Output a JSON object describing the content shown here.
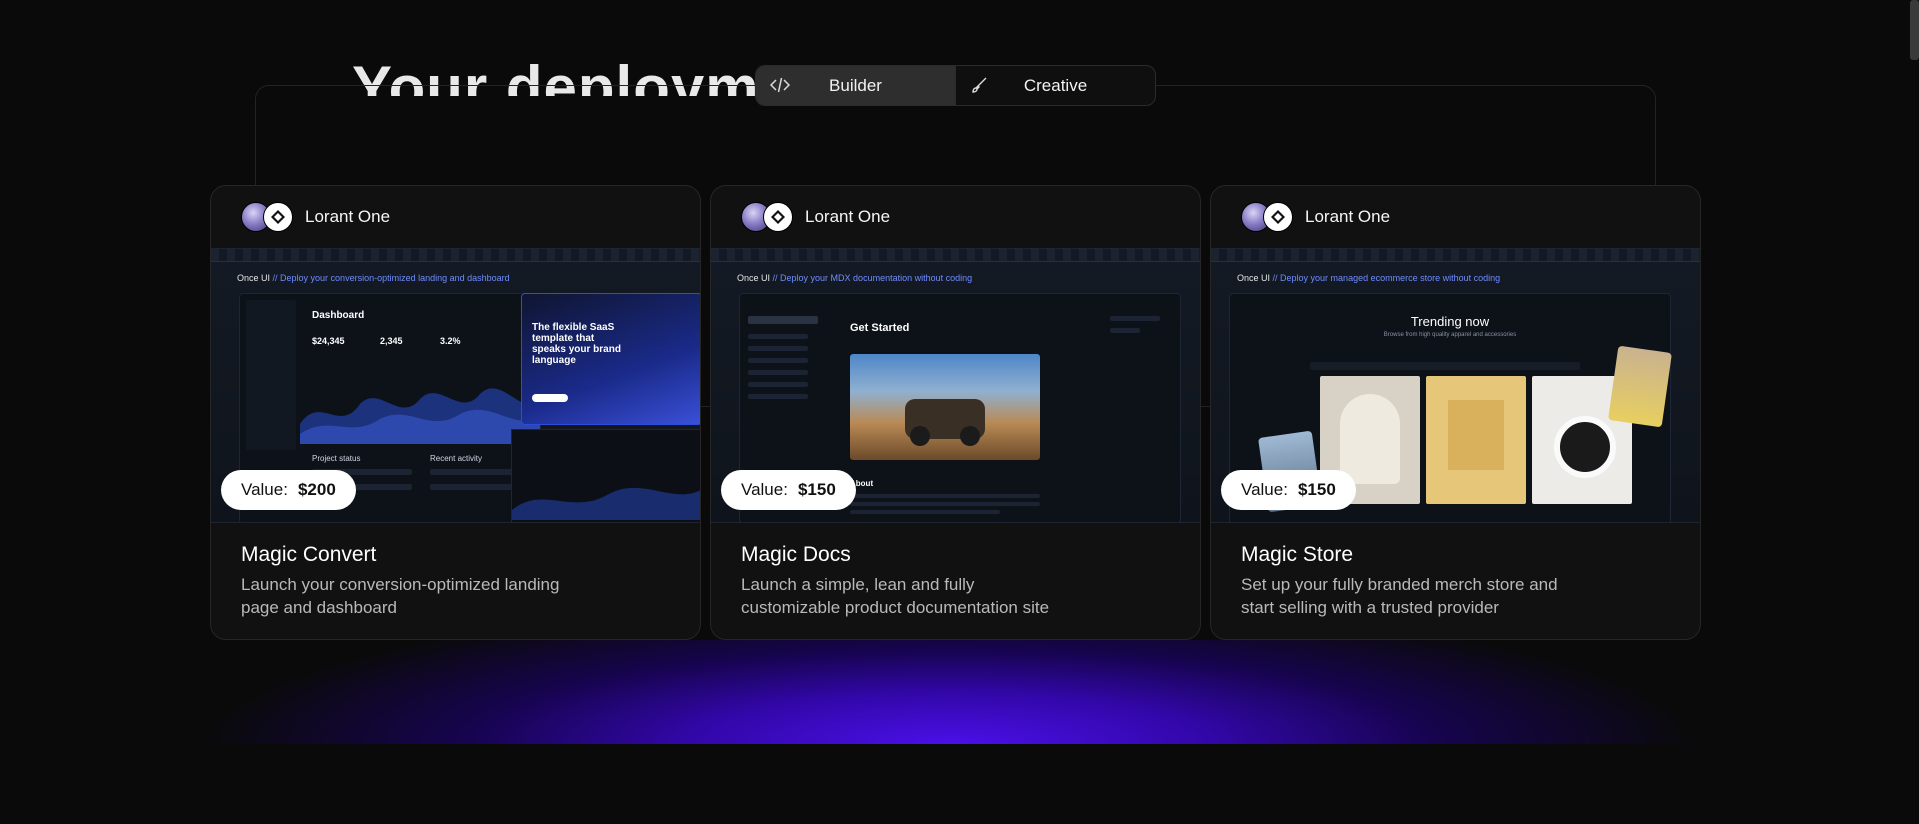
{
  "background_title": "Your deployment",
  "toggle": {
    "options": [
      {
        "label": "Builder",
        "icon": "code-icon",
        "active": true
      },
      {
        "label": "Creative",
        "icon": "brush-icon",
        "active": false
      }
    ]
  },
  "cards": [
    {
      "author": "Lorant One",
      "value_label": "Value:",
      "value": "$200",
      "title": "Magic Convert",
      "description": "Launch your conversion-optimized landing page and dashboard",
      "preview": {
        "brand": "Once UI",
        "tagline": "// Deploy your conversion-optimized landing and dashboard",
        "heading": "Dashboard",
        "stats": [
          "$24,345",
          "2,345",
          "3.2%"
        ],
        "promo": "The flexible SaaS template that speaks your brand language",
        "section_a": "Project status",
        "section_b": "Recent activity"
      }
    },
    {
      "author": "Lorant One",
      "value_label": "Value:",
      "value": "$150",
      "title": "Magic Docs",
      "description": "Launch a simple, lean and fully customizable product documentation site",
      "preview": {
        "brand": "Once UI",
        "tagline": "// Deploy your MDX documentation without coding",
        "heading": "Get Started",
        "section": "About"
      }
    },
    {
      "author": "Lorant One",
      "value_label": "Value:",
      "value": "$150",
      "title": "Magic Store",
      "description": "Set up your fully branded merch store and start selling with a trusted provider",
      "preview": {
        "brand": "Once UI",
        "tagline": "// Deploy your managed ecommerce store without coding",
        "heading": "Trending now",
        "subheading": "Browse from high quality apparel and accessories"
      }
    }
  ],
  "colors": {
    "accent": "#6f8cff",
    "glow": "#4a10e8",
    "background": "#0a0a0a"
  }
}
